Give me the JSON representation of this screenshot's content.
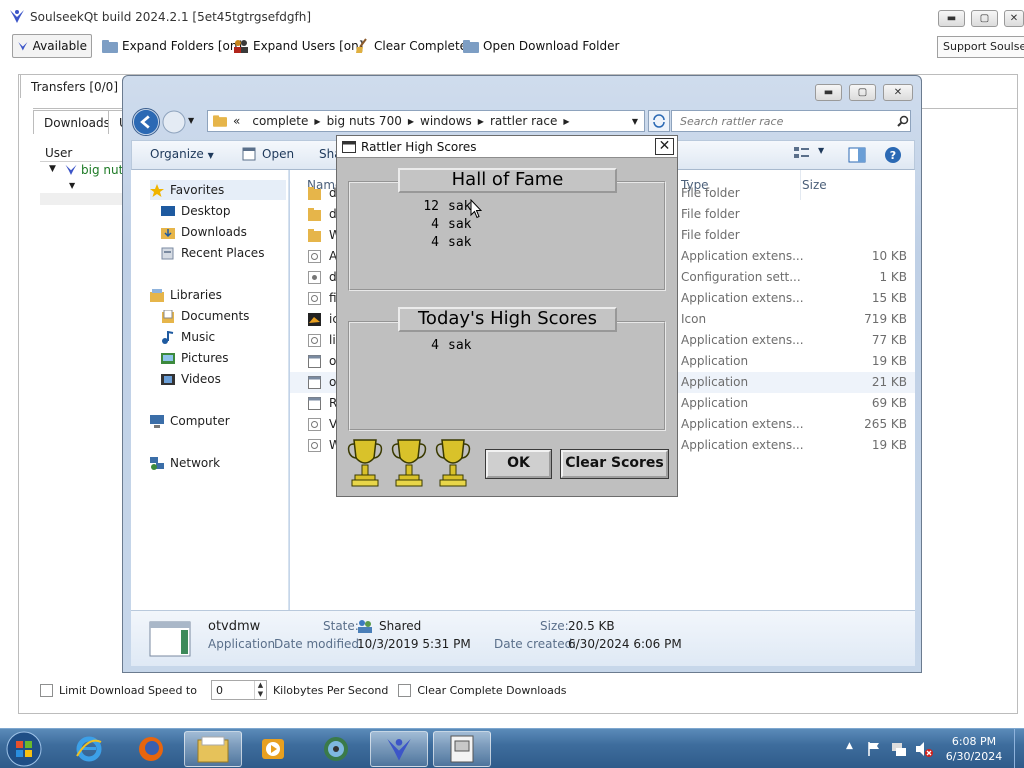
{
  "app": {
    "title": "SoulseekQt build 2024.2.1 [5et45tgtrgsefdgfh]",
    "toolbar": {
      "status_label": "Available",
      "expand_folders": "Expand Folders [on]",
      "expand_users": "Expand Users [on]",
      "clear_complete": "Clear Complete",
      "open_download_folder": "Open Download Folder",
      "support": "Support Soulseek"
    },
    "tabs": {
      "transfers": "Transfers [0/0]"
    },
    "subtabs": {
      "downloads": "Downloads",
      "uploads": "U"
    },
    "table": {
      "user_header": "User",
      "user_row": "big nut"
    },
    "bottom": {
      "limit_label": "Limit Download Speed to",
      "limit_value": "0",
      "unit": "Kilobytes Per Second",
      "clear_complete_downloads": "Clear Complete Downloads"
    }
  },
  "explorer": {
    "breadcrumb": [
      "complete",
      "big nuts 700",
      "windows",
      "rattler race"
    ],
    "breadcrumb_prefix": "«",
    "search_placeholder": "Search rattler race",
    "commands": {
      "organize": "Organize",
      "open": "Open",
      "share": "Sha"
    },
    "nav": {
      "favorites": "Favorites",
      "desktop": "Desktop",
      "downloads": "Downloads",
      "recent": "Recent Places",
      "libraries": "Libraries",
      "documents": "Documents",
      "music": "Music",
      "pictures": "Pictures",
      "videos": "Videos",
      "computer": "Computer",
      "network": "Network"
    },
    "columns": {
      "name": "Name",
      "type": "Type",
      "size": "Size"
    },
    "files": [
      {
        "name": "d",
        "type": "File folder",
        "size": "",
        "icon": "folder-icon"
      },
      {
        "name": "d",
        "type": "File folder",
        "size": "",
        "icon": "folder-icon"
      },
      {
        "name": "W",
        "type": "File folder",
        "size": "",
        "icon": "folder-icon"
      },
      {
        "name": "A",
        "type": "Application extens...",
        "size": "10 KB",
        "icon": "dll-icon"
      },
      {
        "name": "d",
        "type": "Configuration sett...",
        "size": "1 KB",
        "icon": "config-icon"
      },
      {
        "name": "fi",
        "type": "Application extens...",
        "size": "15 KB",
        "icon": "dll-icon"
      },
      {
        "name": "ic",
        "type": "Icon",
        "size": "719 KB",
        "icon": "image-icon"
      },
      {
        "name": "lil",
        "type": "Application extens...",
        "size": "77 KB",
        "icon": "dll-icon"
      },
      {
        "name": "ot",
        "type": "Application",
        "size": "19 KB",
        "icon": "app-icon"
      },
      {
        "name": "ot",
        "type": "Application",
        "size": "21 KB",
        "icon": "app-icon"
      },
      {
        "name": "R",
        "type": "Application",
        "size": "69 KB",
        "icon": "app-icon"
      },
      {
        "name": "V",
        "type": "Application extens...",
        "size": "265 KB",
        "icon": "dll-icon"
      },
      {
        "name": "W",
        "type": "Application extens...",
        "size": "19 KB",
        "icon": "dll-icon"
      }
    ],
    "selected_row": 9,
    "details": {
      "name": "otvdmw",
      "kind": "Application",
      "state_label": "State:",
      "state_value": "Shared",
      "modified_label": "Date modified:",
      "modified_value": "10/3/2019 5:31 PM",
      "size_label": "Size:",
      "size_value": "20.5 KB",
      "created_label": "Date created:",
      "created_value": "6/30/2024 6:06 PM"
    }
  },
  "dialog": {
    "title": "Rattler High Scores",
    "close": "✕",
    "hall_of_fame": {
      "label": "Hall of Fame",
      "scores": [
        {
          "points": "12",
          "name": "sak"
        },
        {
          "points": "4",
          "name": "sak"
        },
        {
          "points": "4",
          "name": "sak"
        }
      ]
    },
    "today": {
      "label": "Today's High Scores",
      "scores": [
        {
          "points": "4",
          "name": "sak"
        }
      ]
    },
    "ok": "OK",
    "clear_scores": "Clear Scores"
  },
  "taskbar": {
    "time": "6:08 PM",
    "date": "6/30/2024"
  },
  "colors": {
    "taskbar": "#3e6d9d",
    "dialog_bg": "#bfbfbf",
    "explorer_chrome": "#c7d7ea",
    "trophy_gold": "#d9c22a"
  }
}
